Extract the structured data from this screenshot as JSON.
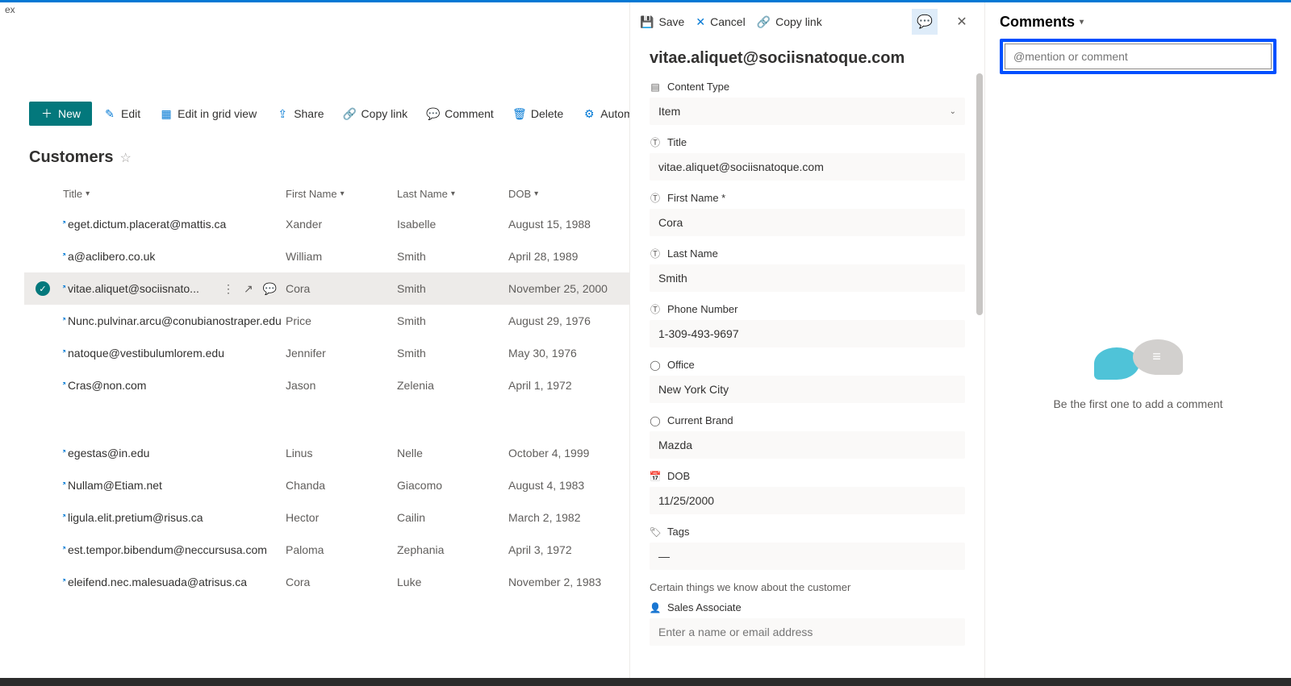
{
  "window": {
    "corner": "ex"
  },
  "toolbar": {
    "new": "New",
    "edit": "Edit",
    "grid": "Edit in grid view",
    "share": "Share",
    "copylink": "Copy link",
    "comment": "Comment",
    "delete": "Delete",
    "automate": "Automate"
  },
  "list": {
    "title": "Customers",
    "columns": {
      "title": "Title",
      "firstName": "First Name",
      "lastName": "Last Name",
      "dob": "DOB"
    },
    "rows": [
      {
        "title": "eget.dictum.placerat@mattis.ca",
        "fn": "Xander",
        "ln": "Isabelle",
        "dob": "August 15, 1988"
      },
      {
        "title": "a@aclibero.co.uk",
        "fn": "William",
        "ln": "Smith",
        "dob": "April 28, 1989"
      },
      {
        "title": "vitae.aliquet@sociisnato...",
        "fn": "Cora",
        "ln": "Smith",
        "dob": "November 25, 2000",
        "selected": true
      },
      {
        "title": "Nunc.pulvinar.arcu@conubianostraper.edu",
        "fn": "Price",
        "ln": "Smith",
        "dob": "August 29, 1976"
      },
      {
        "title": "natoque@vestibulumlorem.edu",
        "fn": "Jennifer",
        "ln": "Smith",
        "dob": "May 30, 1976"
      },
      {
        "title": "Cras@non.com",
        "fn": "Jason",
        "ln": "Zelenia",
        "dob": "April 1, 1972"
      }
    ],
    "rows2": [
      {
        "title": "egestas@in.edu",
        "fn": "Linus",
        "ln": "Nelle",
        "dob": "October 4, 1999"
      },
      {
        "title": "Nullam@Etiam.net",
        "fn": "Chanda",
        "ln": "Giacomo",
        "dob": "August 4, 1983"
      },
      {
        "title": "ligula.elit.pretium@risus.ca",
        "fn": "Hector",
        "ln": "Cailin",
        "dob": "March 2, 1982"
      },
      {
        "title": "est.tempor.bibendum@neccursusa.com",
        "fn": "Paloma",
        "ln": "Zephania",
        "dob": "April 3, 1972"
      },
      {
        "title": "eleifend.nec.malesuada@atrisus.ca",
        "fn": "Cora",
        "ln": "Luke",
        "dob": "November 2, 1983"
      }
    ]
  },
  "panel": {
    "actions": {
      "save": "Save",
      "cancel": "Cancel",
      "copylink": "Copy link"
    },
    "heading": "vitae.aliquet@sociisnatoque.com",
    "fields": {
      "contentType": {
        "label": "Content Type",
        "value": "Item"
      },
      "title": {
        "label": "Title",
        "value": "vitae.aliquet@sociisnatoque.com"
      },
      "firstName": {
        "label": "First Name *",
        "value": "Cora"
      },
      "lastName": {
        "label": "Last Name",
        "value": "Smith"
      },
      "phone": {
        "label": "Phone Number",
        "value": "1-309-493-9697"
      },
      "office": {
        "label": "Office",
        "value": "New York City"
      },
      "brand": {
        "label": "Current Brand",
        "value": "Mazda"
      },
      "dob": {
        "label": "DOB",
        "value": "11/25/2000"
      },
      "tags": {
        "label": "Tags",
        "value": "—"
      },
      "sectionNote": "Certain things we know about the customer",
      "salesAssoc": {
        "label": "Sales Associate",
        "placeholder": "Enter a name or email address"
      }
    }
  },
  "comments": {
    "title": "Comments",
    "placeholder": "@mention or comment",
    "empty": "Be the first one to add a comment"
  }
}
